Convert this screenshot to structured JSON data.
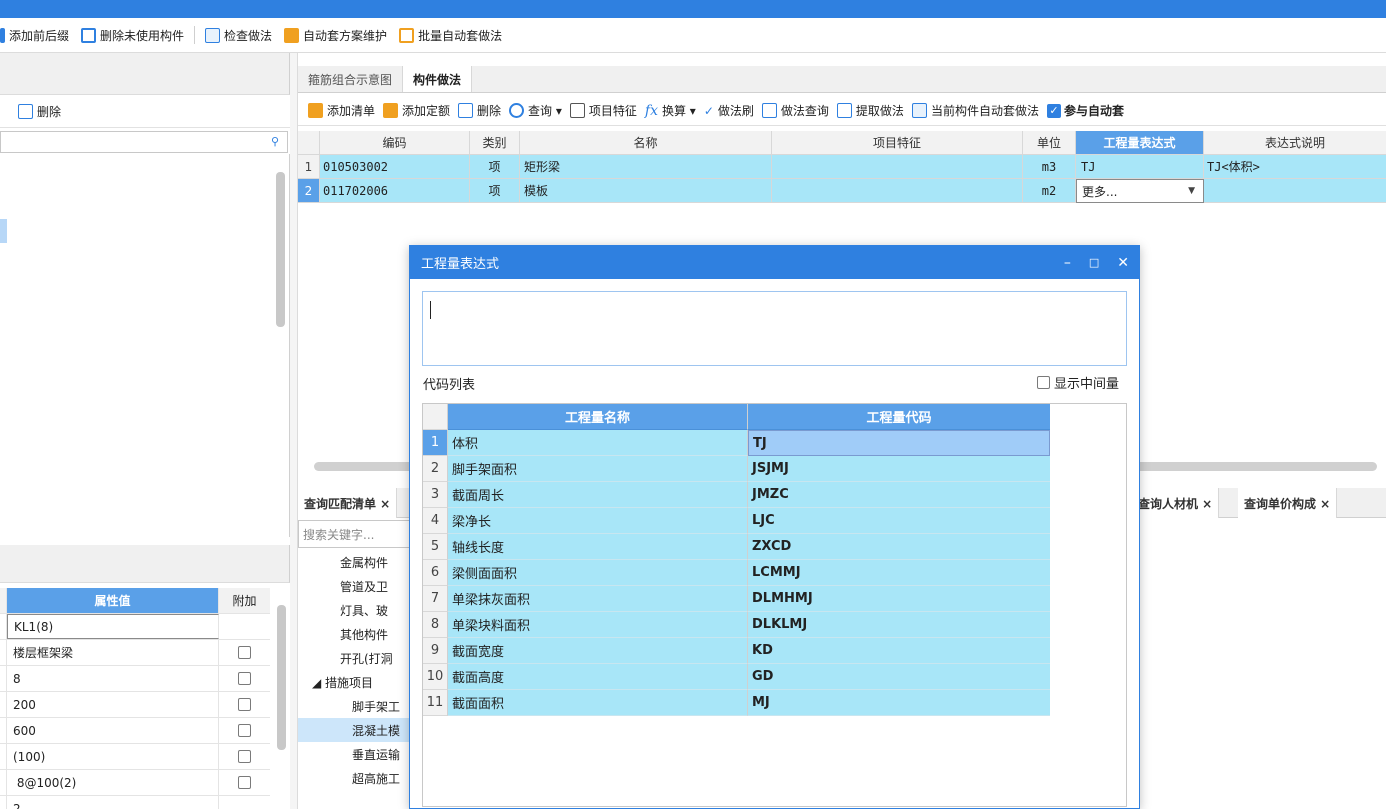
{
  "toolbar": {
    "items": [
      {
        "label": "添加前后缀",
        "icon": "add-prefix-icon",
        "color": "#2f80e0"
      },
      {
        "label": "删除未使用构件",
        "icon": "list-delete-icon",
        "color": "#2f80e0"
      },
      {
        "label": "检查做法",
        "icon": "check-method-icon",
        "color": "#2f80e0"
      },
      {
        "label": "自动套方案维护",
        "icon": "auto-scheme-icon",
        "color": "#f0a020"
      },
      {
        "label": "批量自动套做法",
        "icon": "batch-auto-icon",
        "color": "#f0a020"
      }
    ]
  },
  "left": {
    "delete_label": "删除",
    "properties": {
      "header_value": "属性值",
      "header_extra": "附加",
      "rows": [
        {
          "value": "KL1(8)",
          "has_check": false,
          "editing": true
        },
        {
          "value": "楼层框架梁",
          "has_check": true,
          "editing": false
        },
        {
          "value": "8",
          "has_check": true,
          "editing": false
        },
        {
          "value": "200",
          "has_check": true,
          "editing": false
        },
        {
          "value": "600",
          "has_check": true,
          "editing": false
        },
        {
          "value": "(100)",
          "has_check": true,
          "editing": false
        },
        {
          "value": " 8@100(2)",
          "has_check": true,
          "editing": false
        },
        {
          "value": "2",
          "has_check": false,
          "editing": false
        }
      ]
    }
  },
  "tabs": [
    {
      "label": "箍筋组合示意图",
      "active": false
    },
    {
      "label": "构件做法",
      "active": true
    }
  ],
  "method_toolbar": {
    "items": [
      {
        "label": "添加清单",
        "icon": "add-list-icon"
      },
      {
        "label": "添加定额",
        "icon": "add-quota-icon"
      },
      {
        "label": "删除",
        "icon": "delete-icon"
      },
      {
        "label": "查询 ▾",
        "icon": "query-icon"
      },
      {
        "label": "项目特征",
        "icon": "feature-icon"
      },
      {
        "label": "换算 ▾",
        "icon": "fx-icon"
      },
      {
        "label": "做法刷",
        "icon": "brush-icon"
      },
      {
        "label": "做法查询",
        "icon": "method-query-icon"
      },
      {
        "label": "提取做法",
        "icon": "extract-icon"
      },
      {
        "label": "当前构件自动套做法",
        "icon": "auto-current-icon"
      },
      {
        "label": "参与自动套",
        "icon": "checkbox-checked-icon"
      }
    ]
  },
  "grid": {
    "headers": [
      "编码",
      "类别",
      "名称",
      "项目特征",
      "单位",
      "工程量表达式",
      "表达式说明"
    ],
    "rows": [
      {
        "no": "1",
        "code": "010503002",
        "type": "项",
        "name": "矩形梁",
        "feature": "",
        "unit": "m3",
        "expr": "TJ",
        "desc": "TJ<体积>"
      },
      {
        "no": "2",
        "code": "011702006",
        "type": "项",
        "name": "模板",
        "feature": "",
        "unit": "m2",
        "expr": "更多...",
        "desc": ""
      }
    ]
  },
  "bottom": {
    "tabs": [
      "查询匹配清单 ×",
      "查询人材机 ×",
      "查询单价构成 ×"
    ],
    "search_placeholder": "搜索关键字...",
    "tree_items": [
      "金属构件",
      "管道及卫",
      "灯具、玻",
      "其他构件",
      "开孔(打洞",
      "◢ 措施项目",
      "脚手架工",
      "混凝土模",
      "垂直运输",
      "超高施工"
    ]
  },
  "dialog": {
    "title": "工程量表达式",
    "editor_value": "",
    "code_list_label": "代码列表",
    "show_intermediate_label": "显示中间量",
    "table": {
      "headers": [
        "工程量名称",
        "工程量代码"
      ],
      "rows": [
        {
          "no": "1",
          "name": "体积",
          "code": "TJ"
        },
        {
          "no": "2",
          "name": "脚手架面积",
          "code": "JSJMJ"
        },
        {
          "no": "3",
          "name": "截面周长",
          "code": "JMZC"
        },
        {
          "no": "4",
          "name": "梁净长",
          "code": "LJC"
        },
        {
          "no": "5",
          "name": "轴线长度",
          "code": "ZXCD"
        },
        {
          "no": "6",
          "name": "梁侧面面积",
          "code": "LCMMJ"
        },
        {
          "no": "7",
          "name": "单梁抹灰面积",
          "code": "DLMHMJ"
        },
        {
          "no": "8",
          "name": "单梁块料面积",
          "code": "DLKLMJ"
        },
        {
          "no": "9",
          "name": "截面宽度",
          "code": "KD"
        },
        {
          "no": "10",
          "name": "截面高度",
          "code": "GD"
        },
        {
          "no": "11",
          "name": "截面面积",
          "code": "MJ"
        }
      ]
    }
  },
  "colors": {
    "accent": "#2f80e0",
    "row_highlight": "#a8e6f8",
    "header_blue": "#5aa0e8"
  }
}
